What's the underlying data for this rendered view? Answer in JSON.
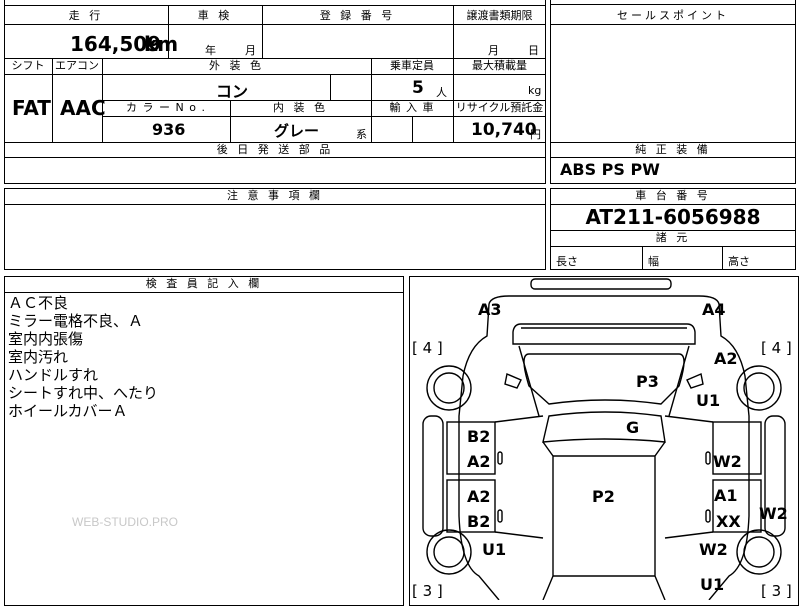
{
  "header": {
    "mileage_label": "走 行",
    "inspection_label": "車 検",
    "registration_label": "登 録 番 号",
    "transfer_doc_label": "譲渡書類期限",
    "sales_points_label": "セールスポイント",
    "mileage_value": "164,509",
    "mileage_unit": "km",
    "year_unit": "年",
    "month_unit": "月",
    "transfer_month": "月",
    "transfer_day": "日"
  },
  "specs": {
    "shift_label": "シフト",
    "ac_label": "エアコン",
    "ext_color_label": "外 装 色",
    "capacity_label": "乗車定員",
    "max_load_label": "最大積載量",
    "shift_value": "FAT",
    "ac_value": "AAC",
    "ext_color_value": "コン",
    "capacity_value": "5",
    "capacity_unit": "人",
    "load_unit": "kg",
    "color_no_label": "カ ラ ー N o .",
    "int_color_label": "内 装 色",
    "import_label": "輸 入 車",
    "recycle_label": "リサイクル預託金",
    "color_no_value": "936",
    "int_color_value": "グレー",
    "int_color_suffix": "系",
    "recycle_value": "10,740",
    "recycle_unit": "円",
    "later_parts_label": "後 日 発 送 部 品"
  },
  "equipment": {
    "label": "純 正 装 備",
    "value": "ABS PS PW"
  },
  "notes": {
    "label": "注 意 事 項 欄"
  },
  "chassis": {
    "label": "車 台 番 号",
    "value": "AT211-6056988",
    "dims_label": "諸 元",
    "length_label": "長さ",
    "width_label": "幅",
    "height_label": "高さ"
  },
  "inspector": {
    "label": "検 査 員 記 入 欄",
    "lines": [
      "ＡＣ不良",
      "ミラー電格不良、Ａ",
      "室内内張傷",
      "室内汚れ",
      "ハンドルすれ",
      "シートすれ中、へたり",
      "ホイールカバーＡ"
    ],
    "watermark": "WEB-STUDIO.PRO"
  },
  "diagram": {
    "tire_fl": "[ 4 ]",
    "tire_fr": "[ 4 ]",
    "tire_rl": "[ 3 ]",
    "tire_rr": "[ 3 ]",
    "marks": {
      "a3": "A3",
      "a4": "A4",
      "a2_top_right": "A2",
      "u1_right": "U1",
      "p3": "P3",
      "g": "G",
      "b2_left": "B2",
      "a2_left": "A2",
      "w2_right_door": "W2",
      "a2_left_rear": "A2",
      "b2_left_rear": "B2",
      "p2": "P2",
      "a1_right": "A1",
      "xx_right": "XX",
      "w2_side": "W2",
      "u1_left": "U1",
      "w2_right_lower": "W2",
      "u1_bottom": "U1"
    }
  }
}
